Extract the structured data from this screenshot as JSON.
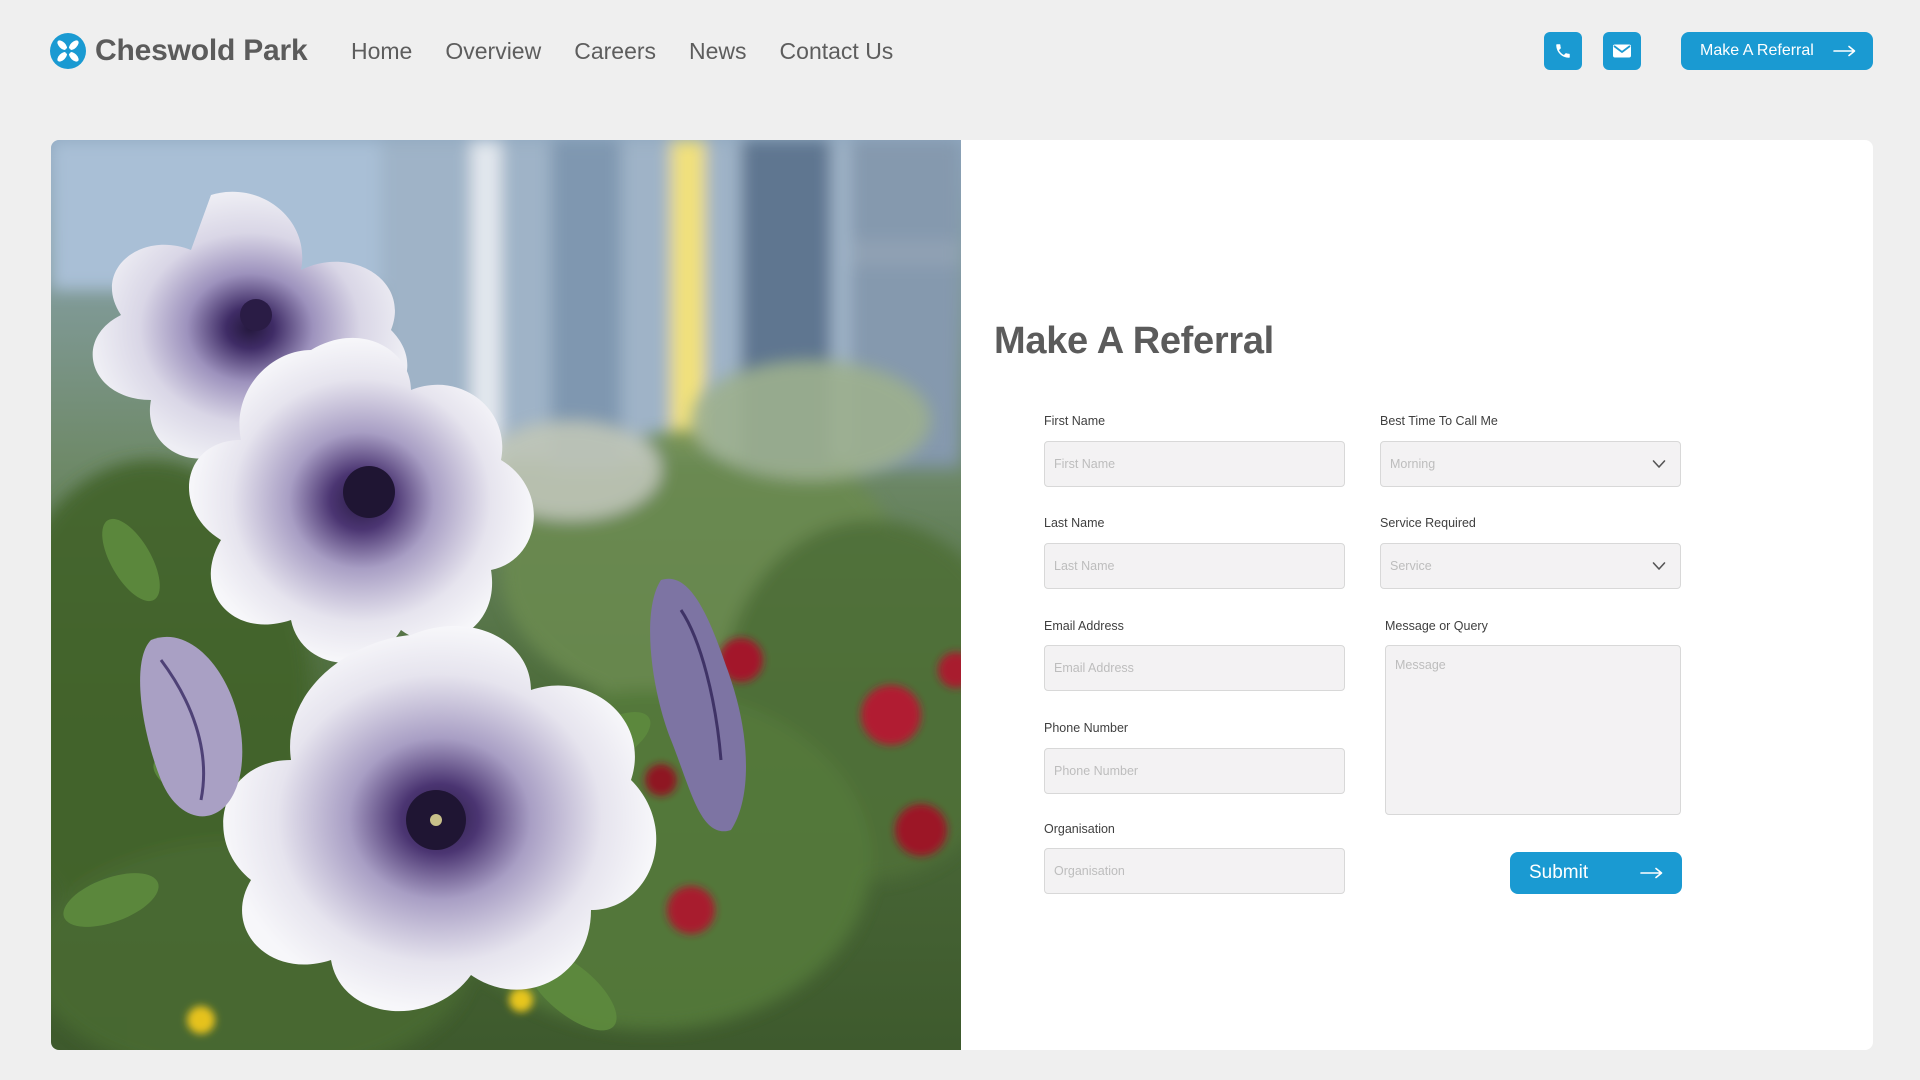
{
  "brand": {
    "name": "Cheswold Park",
    "accent_color": "#1a9ad2"
  },
  "nav": {
    "items": [
      "Home",
      "Overview",
      "Careers",
      "News",
      "Contact Us"
    ]
  },
  "header": {
    "phone_icon": "phone-icon",
    "mail_icon": "mail-icon",
    "cta_label": "Make A Referral"
  },
  "form": {
    "title": "Make A Referral",
    "first_name": {
      "label": "First Name",
      "placeholder": "First Name",
      "value": ""
    },
    "last_name": {
      "label": "Last Name",
      "placeholder": "Last Name",
      "value": ""
    },
    "email": {
      "label": "Email Address",
      "placeholder": "Email Address",
      "value": ""
    },
    "phone": {
      "label": "Phone Number",
      "placeholder": "Phone Number",
      "value": ""
    },
    "organisation": {
      "label": "Organisation",
      "placeholder": "Organisation",
      "value": ""
    },
    "best_time": {
      "label": "Best Time To Call Me",
      "selected": "Morning"
    },
    "service": {
      "label": "Service Required",
      "selected": "Service"
    },
    "message": {
      "label": "Message or Query",
      "placeholder": "Message",
      "value": ""
    },
    "submit_label": "Submit"
  },
  "image": {
    "subject": "petunia-flowers-photo"
  }
}
